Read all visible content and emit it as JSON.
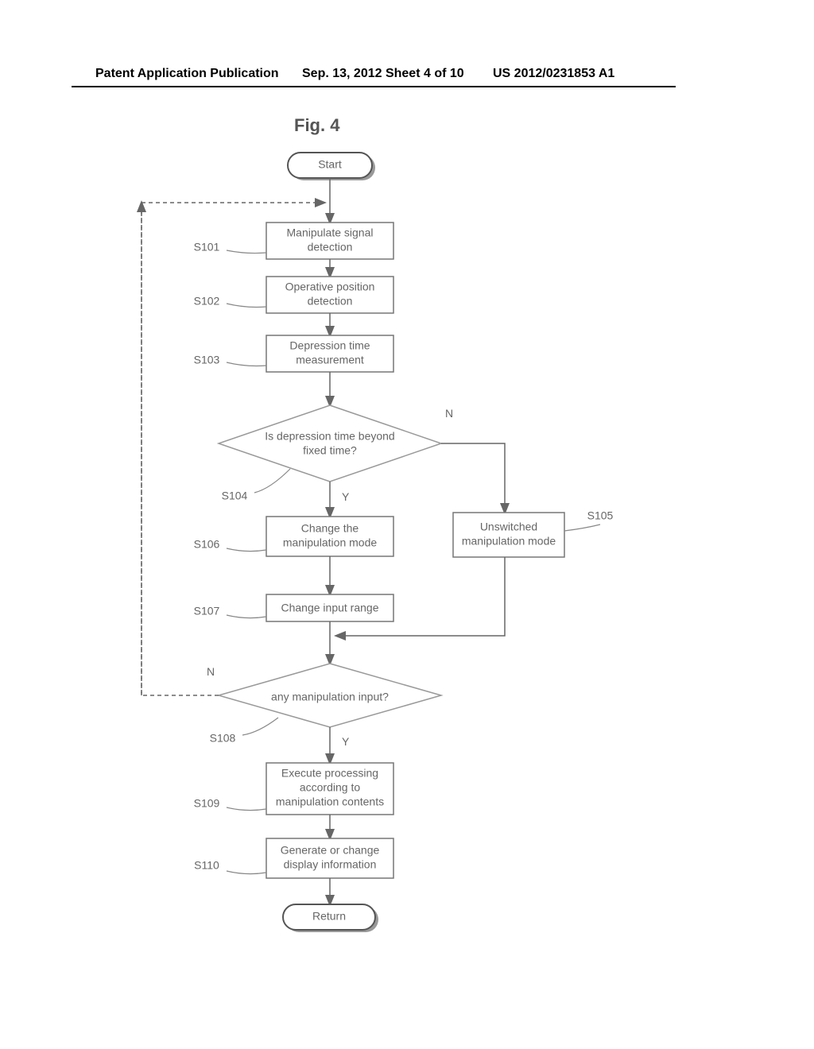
{
  "header": {
    "left": "Patent Application Publication",
    "center": "Sep. 13, 2012  Sheet 4 of 10",
    "right": "US 2012/0231853 A1"
  },
  "figure_title": "Fig. 4",
  "nodes": {
    "start": "Start",
    "s101": {
      "label": "S101",
      "text1": "Manipulate signal",
      "text2": "detection"
    },
    "s102": {
      "label": "S102",
      "text1": "Operative position",
      "text2": "detection"
    },
    "s103": {
      "label": "S103",
      "text1": "Depression time",
      "text2": "measurement"
    },
    "s104": {
      "label": "S104",
      "text1": "Is depression time beyond",
      "text2": "fixed time?"
    },
    "s105": {
      "label": "S105",
      "text1": "Unswitched",
      "text2": "manipulation mode"
    },
    "s106": {
      "label": "S106",
      "text1": "Change the",
      "text2": "manipulation mode"
    },
    "s107": {
      "label": "S107",
      "text": "Change input range"
    },
    "s108": {
      "label": "S108",
      "text": "any manipulation input?"
    },
    "s109": {
      "label": "S109",
      "text1": "Execute processing",
      "text2": "according to",
      "text3": "manipulation contents"
    },
    "s110": {
      "label": "S110",
      "text1": "Generate or change",
      "text2": "display information"
    },
    "return": "Return"
  },
  "yn": {
    "y": "Y",
    "n": "N"
  }
}
